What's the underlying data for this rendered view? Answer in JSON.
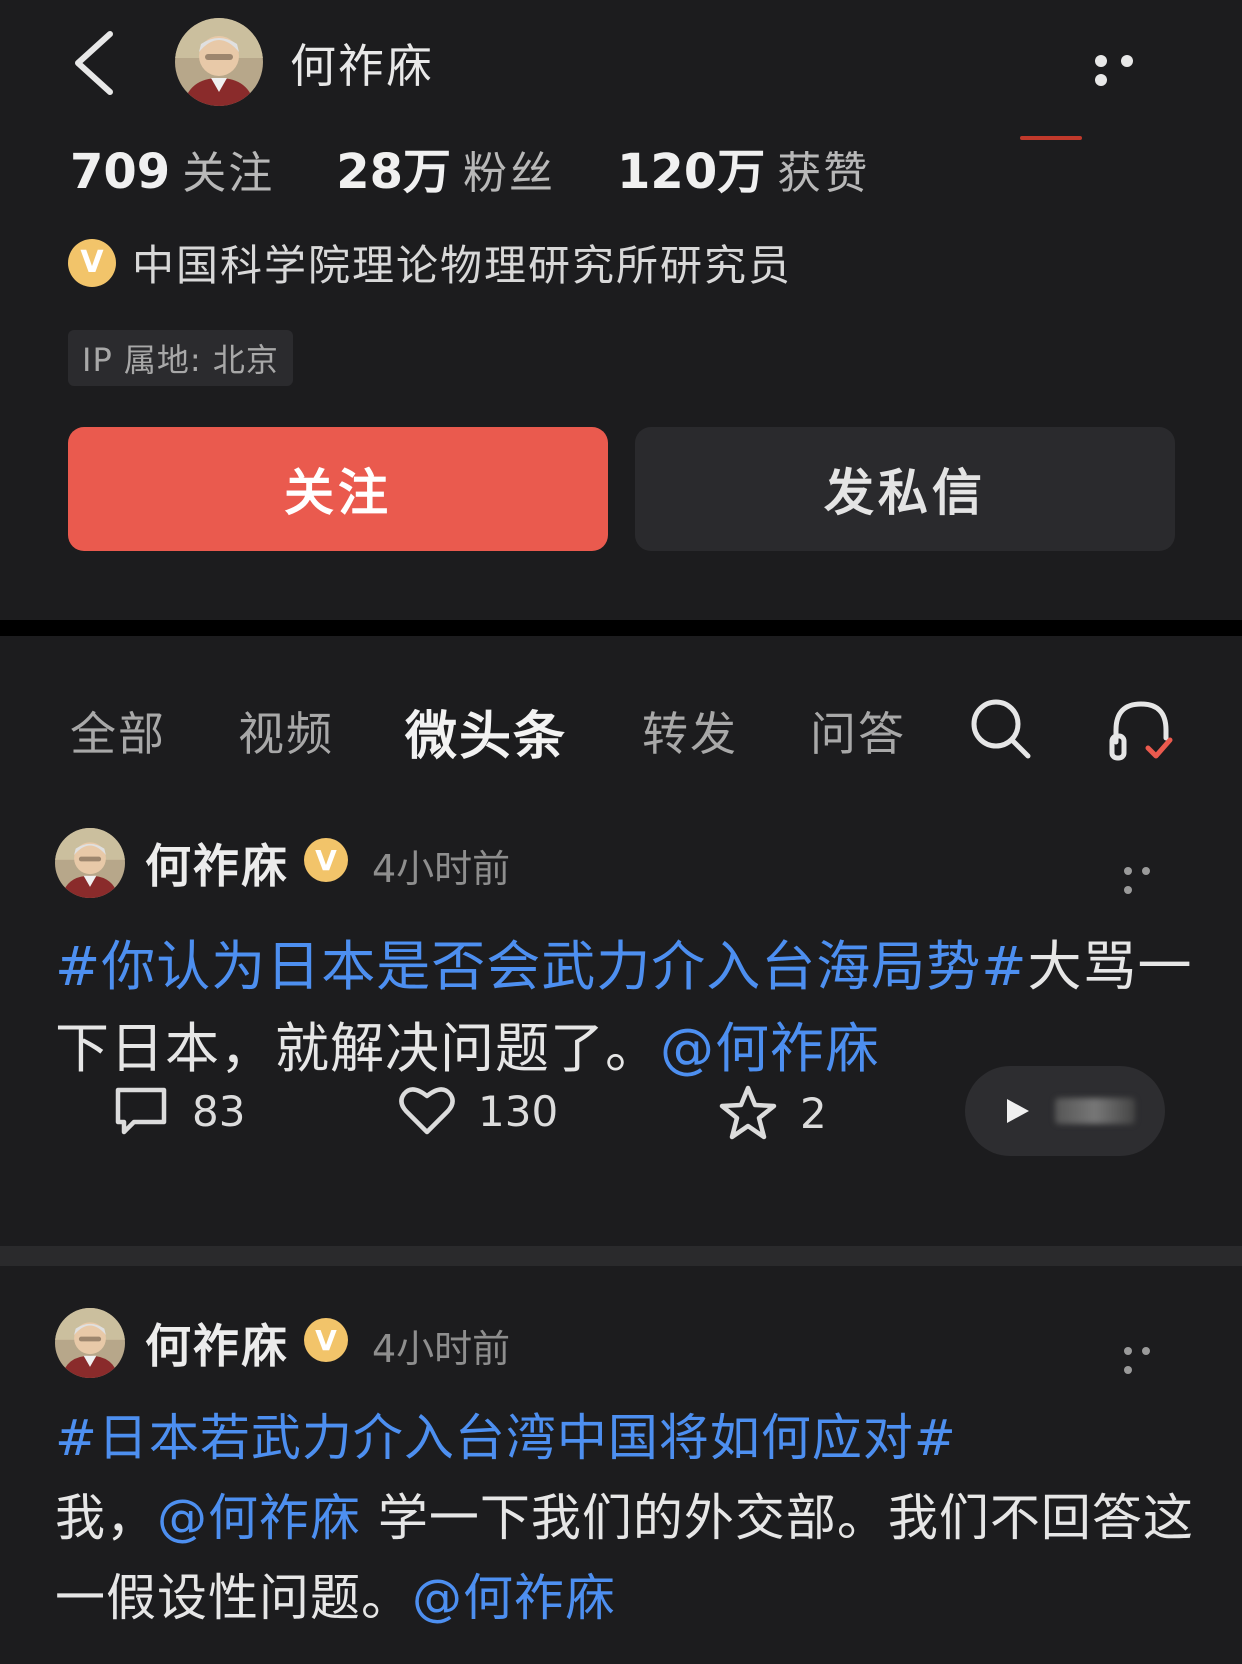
{
  "header": {
    "name": "何祚庥"
  },
  "stats": [
    {
      "num": "709",
      "label": "关注"
    },
    {
      "num": "28万",
      "label": "粉丝"
    },
    {
      "num": "120万",
      "label": "获赞"
    }
  ],
  "verify": {
    "badge": "V",
    "text": "中国科学院理论物理研究所研究员"
  },
  "ip_tag": "IP 属地: 北京",
  "buttons": {
    "follow": "关注",
    "message": "发私信"
  },
  "tabs": [
    "全部",
    "视频",
    "微头条",
    "转发",
    "问答"
  ],
  "active_tab": "微头条",
  "colors": {
    "accent_red": "#ea5a4e",
    "link_blue": "#4d8ff0",
    "badge_gold": "#f2c46a",
    "background": "#1c1c1e"
  },
  "posts": [
    {
      "author": "何祚庥",
      "badge": "V",
      "time": "4小时前",
      "topic": "#你认为日本是否会武力介入台海局势#",
      "text_a": "大骂一下日本，就解决问题了。",
      "mention": "@何祚庥",
      "comments": "83",
      "likes": "130",
      "favorites": "2"
    },
    {
      "author": "何祚庥",
      "badge": "V",
      "time": "4小时前",
      "topic": "#日本若武力介入台湾中国将如何应对#",
      "text_a": "我，",
      "mention_a": "@何祚庥",
      "text_b": " 学一下我们的外交部。我们不回答这一假设性问题。",
      "mention_b": "@何祚庥"
    }
  ]
}
